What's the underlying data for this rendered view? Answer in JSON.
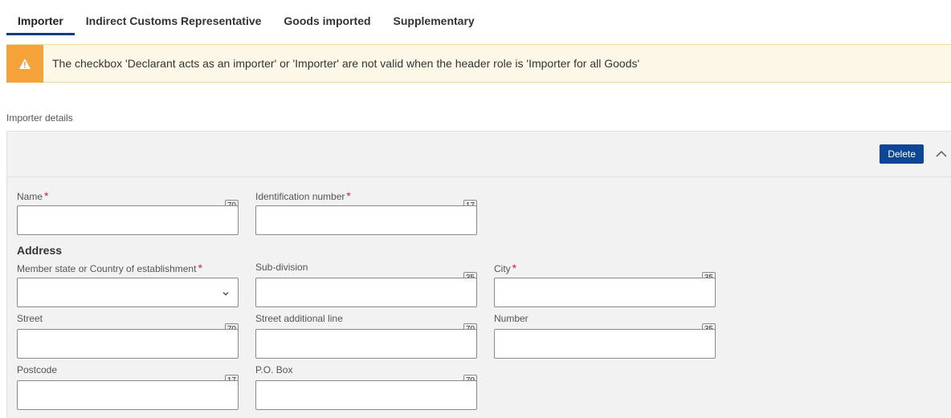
{
  "tabs": [
    {
      "label": "Importer",
      "active": true
    },
    {
      "label": "Indirect Customs Representative",
      "active": false
    },
    {
      "label": "Goods imported",
      "active": false
    },
    {
      "label": "Supplementary",
      "active": false
    }
  ],
  "warning": {
    "icon": "warning-triangle-icon",
    "text": "The checkbox 'Declarant acts as an importer' or 'Importer' are not valid when the header role is 'Importer for all Goods'",
    "color": "#f5a23a"
  },
  "section": {
    "label": "Importer details",
    "delete_label": "Delete",
    "address_heading": "Address"
  },
  "fields": {
    "name": {
      "label": "Name",
      "required": "*",
      "max": "70",
      "value": ""
    },
    "identification_number": {
      "label": "Identification number",
      "required": "*",
      "max": "17",
      "value": ""
    },
    "member_state": {
      "label": "Member state or Country of establishment",
      "required": "*",
      "value": ""
    },
    "sub_division": {
      "label": "Sub-division",
      "max": "35",
      "value": ""
    },
    "city": {
      "label": "City",
      "required": "*",
      "max": "35",
      "value": ""
    },
    "street": {
      "label": "Street",
      "max": "70",
      "value": ""
    },
    "street_additional": {
      "label": "Street additional line",
      "max": "70",
      "value": ""
    },
    "number": {
      "label": "Number",
      "max": "35",
      "value": ""
    },
    "postcode": {
      "label": "Postcode",
      "max": "17",
      "value": ""
    },
    "po_box": {
      "label": "P.O. Box",
      "max": "70",
      "value": ""
    }
  },
  "colors": {
    "accent": "#0e4595",
    "tab_underline": "#0e3e7c",
    "required": "#d4202b",
    "warning_bg": "#fdf7e8"
  }
}
